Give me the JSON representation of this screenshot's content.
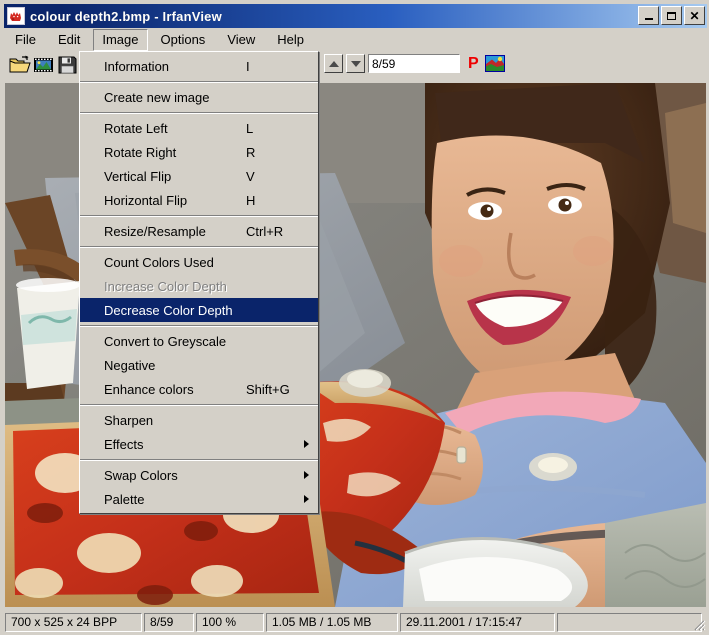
{
  "window": {
    "title": "colour depth2.bmp - IrfanView",
    "icon": "irfanview-cat-icon",
    "buttons": {
      "minimize": "minimize-icon",
      "maximize": "maximize-icon",
      "close": "close-icon"
    }
  },
  "menubar": {
    "items": [
      {
        "label": "File",
        "active": false
      },
      {
        "label": "Edit",
        "active": false
      },
      {
        "label": "Image",
        "active": true
      },
      {
        "label": "Options",
        "active": false
      },
      {
        "label": "View",
        "active": false
      },
      {
        "label": "Help",
        "active": false
      }
    ]
  },
  "toolbar": {
    "left_icons": [
      {
        "name": "open-folder-icon"
      },
      {
        "name": "thumbnails-filmstrip-icon"
      },
      {
        "name": "save-disk-icon"
      }
    ],
    "prev_arrow": "arrow-up-icon",
    "next_arrow": "arrow-down-icon",
    "page_value": "8/59",
    "print_letter": "P",
    "paint_icon": "paint-picture-icon"
  },
  "image_menu": {
    "items": [
      {
        "label": "Information",
        "shortcut": "I",
        "state": "normal",
        "submenu": false
      },
      {
        "type": "separator"
      },
      {
        "label": "Create new image",
        "shortcut": "",
        "state": "normal",
        "submenu": false
      },
      {
        "type": "separator"
      },
      {
        "label": "Rotate Left",
        "shortcut": "L",
        "state": "normal",
        "submenu": false
      },
      {
        "label": "Rotate Right",
        "shortcut": "R",
        "state": "normal",
        "submenu": false
      },
      {
        "label": "Vertical Flip",
        "shortcut": "V",
        "state": "normal",
        "submenu": false
      },
      {
        "label": "Horizontal Flip",
        "shortcut": "H",
        "state": "normal",
        "submenu": false
      },
      {
        "type": "separator"
      },
      {
        "label": "Resize/Resample",
        "shortcut": "Ctrl+R",
        "state": "normal",
        "submenu": false
      },
      {
        "type": "separator"
      },
      {
        "label": "Count Colors Used",
        "shortcut": "",
        "state": "normal",
        "submenu": false
      },
      {
        "label": "Increase Color Depth",
        "shortcut": "",
        "state": "disabled",
        "submenu": false
      },
      {
        "label": "Decrease Color Depth",
        "shortcut": "",
        "state": "selected",
        "submenu": false
      },
      {
        "type": "separator"
      },
      {
        "label": "Convert to Greyscale",
        "shortcut": "",
        "state": "normal",
        "submenu": false
      },
      {
        "label": "Negative",
        "shortcut": "",
        "state": "normal",
        "submenu": false
      },
      {
        "label": "Enhance colors",
        "shortcut": "Shift+G",
        "state": "normal",
        "submenu": false
      },
      {
        "type": "separator"
      },
      {
        "label": "Sharpen",
        "shortcut": "",
        "state": "normal",
        "submenu": false
      },
      {
        "label": "Effects",
        "shortcut": "",
        "state": "normal",
        "submenu": true
      },
      {
        "type": "separator"
      },
      {
        "label": "Swap Colors",
        "shortcut": "",
        "state": "normal",
        "submenu": true
      },
      {
        "label": "Palette",
        "shortcut": "",
        "state": "normal",
        "submenu": true
      }
    ]
  },
  "statusbar": {
    "dimensions": "700 x 525 x 24 BPP",
    "page": "8/59",
    "zoom": "100 %",
    "size": "1.05 MB / 1.05 MB",
    "datetime": "29.11.2001 / 17:15:47",
    "grip": "resize-grip-icon"
  },
  "colors": {
    "title_active": "#0a246a",
    "menu_highlight": "#0a246a",
    "face": "#d4d0c8",
    "accent_red": "#ee0000"
  }
}
